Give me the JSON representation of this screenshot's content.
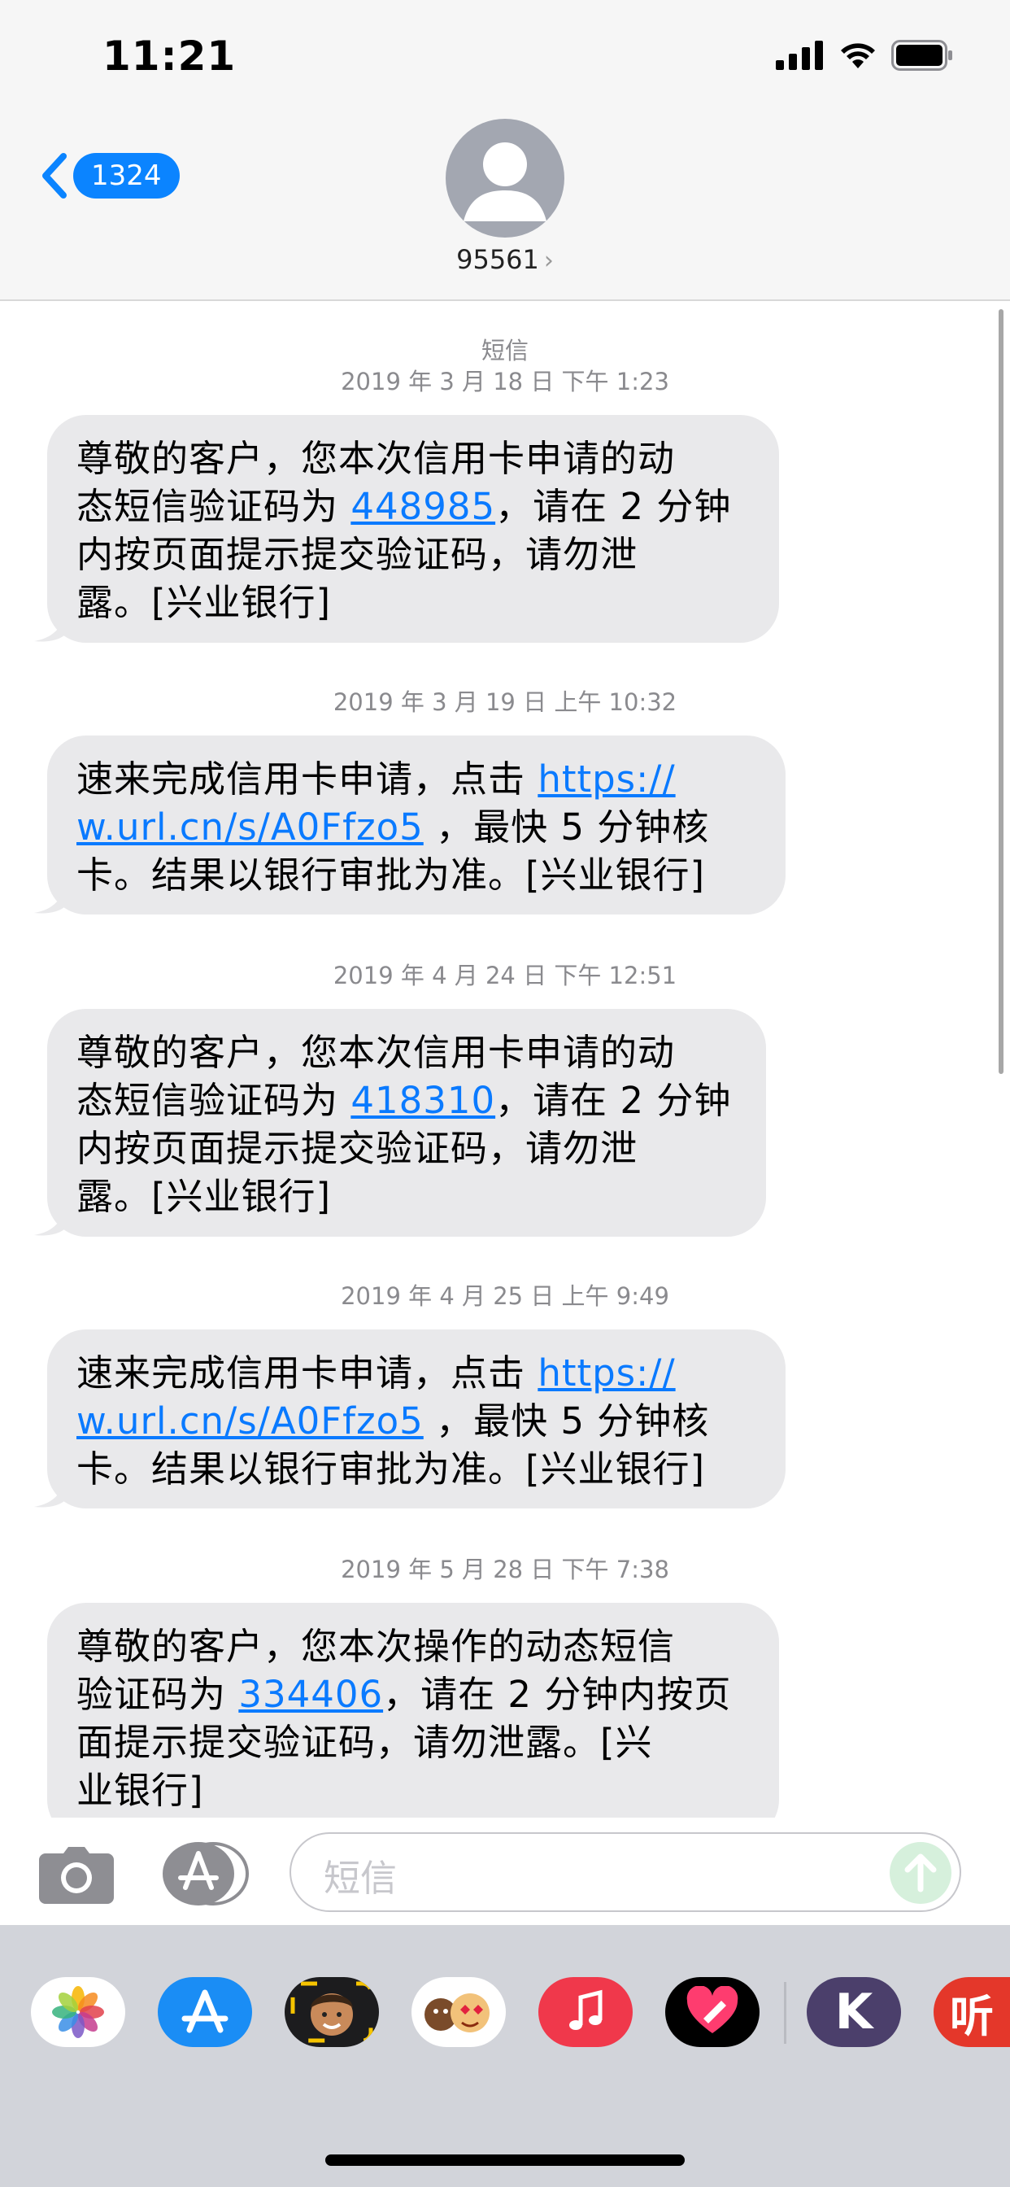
{
  "status": {
    "time": "11:21"
  },
  "header": {
    "back_count": "1324",
    "contact_name": "95561",
    "contact_chevron": "›"
  },
  "thread": {
    "service_label": "短信",
    "messages": [
      {
        "timestamp": "2019 年 3 月 18 日 下午 1:23",
        "lines": [
          {
            "before": "尊敬的客户，您本次信用卡申请的动",
            "link": "",
            "after": ""
          },
          {
            "before": "态短信验证码为 ",
            "link": "448985",
            "after": "，请在 2 分钟"
          },
          {
            "before": "内按页面提示提交验证码，请勿泄",
            "link": "",
            "after": ""
          },
          {
            "before": "露。[兴业银行]",
            "link": "",
            "after": ""
          }
        ]
      },
      {
        "timestamp": "2019 年 3 月 19 日 上午 10:32",
        "lines": [
          {
            "before": "速来完成信用卡申请，点击 ",
            "link": "https://",
            "after": ""
          },
          {
            "before": "",
            "link": "w.url.cn/s/A0Ffzo5",
            "after": " ，最快 5 分钟核"
          },
          {
            "before": "卡。结果以银行审批为准。[兴业银行]",
            "link": "",
            "after": ""
          }
        ]
      },
      {
        "timestamp": "2019 年 4 月 24 日 下午 12:51",
        "lines": [
          {
            "before": "尊敬的客户，您本次信用卡申请的动",
            "link": "",
            "after": ""
          },
          {
            "before": "态短信验证码为 ",
            "link": "418310",
            "after": "，请在 2 分钟"
          },
          {
            "before": "内按页面提示提交验证码，请勿泄",
            "link": "",
            "after": ""
          },
          {
            "before": "露。[兴业银行]",
            "link": "",
            "after": ""
          }
        ]
      },
      {
        "timestamp": "2019 年 4 月 25 日 上午 9:49",
        "lines": [
          {
            "before": "速来完成信用卡申请，点击 ",
            "link": "https://",
            "after": ""
          },
          {
            "before": "",
            "link": "w.url.cn/s/A0Ffzo5",
            "after": " ，最快 5 分钟核"
          },
          {
            "before": "卡。结果以银行审批为准。[兴业银行]",
            "link": "",
            "after": ""
          }
        ]
      },
      {
        "timestamp": "2019 年 5 月 28 日 下午 7:38",
        "lines": [
          {
            "before": "尊敬的客户，您本次操作的动态短信",
            "link": "",
            "after": ""
          },
          {
            "before": "验证码为 ",
            "link": "334406",
            "after": "，请在 2 分钟内按页"
          },
          {
            "before": "面提示提交验证码，请勿泄露。[兴",
            "link": "",
            "after": ""
          },
          {
            "before": "业银行]",
            "link": "",
            "after": ""
          }
        ]
      }
    ]
  },
  "composer": {
    "placeholder": "短信"
  },
  "app_tray": {
    "apps": [
      {
        "name": "photos-app-icon"
      },
      {
        "name": "app-store-app-icon"
      },
      {
        "name": "memoji-app-icon"
      },
      {
        "name": "memoji-stickers-app-icon"
      },
      {
        "name": "music-app-icon"
      },
      {
        "name": "digital-touch-app-icon"
      },
      {
        "name": "k-app-icon",
        "label": "K"
      },
      {
        "name": "listen-app-icon",
        "label": "听"
      }
    ]
  }
}
